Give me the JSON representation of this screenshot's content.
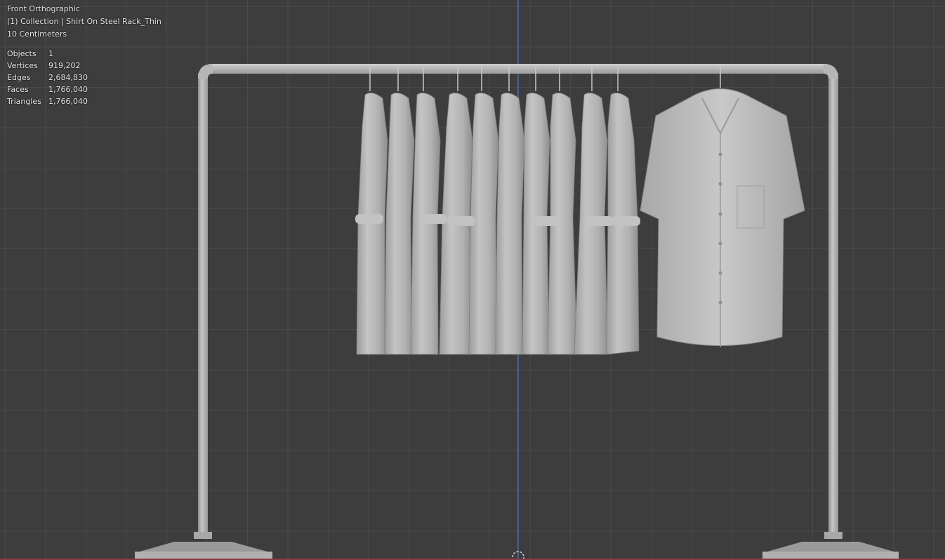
{
  "viewport": {
    "view_name": "Front Orthographic",
    "collection_label": "(1) Collection | Shirt On Steel Rack_Thin",
    "scale_label": "10 Centimeters"
  },
  "stats": [
    {
      "label": "Objects",
      "value": "1"
    },
    {
      "label": "Vertices",
      "value": "919,202"
    },
    {
      "label": "Edges",
      "value": "2,684,830"
    },
    {
      "label": "Faces",
      "value": "1,766,040"
    },
    {
      "label": "Triangles",
      "value": "1,766,040"
    }
  ],
  "colors": {
    "background": "#3d3d3d",
    "grid": "#4a4a4a",
    "axis_z": "#4a6fa8",
    "axis_x": "#8a3a44",
    "mesh": "#b4b4b4"
  }
}
